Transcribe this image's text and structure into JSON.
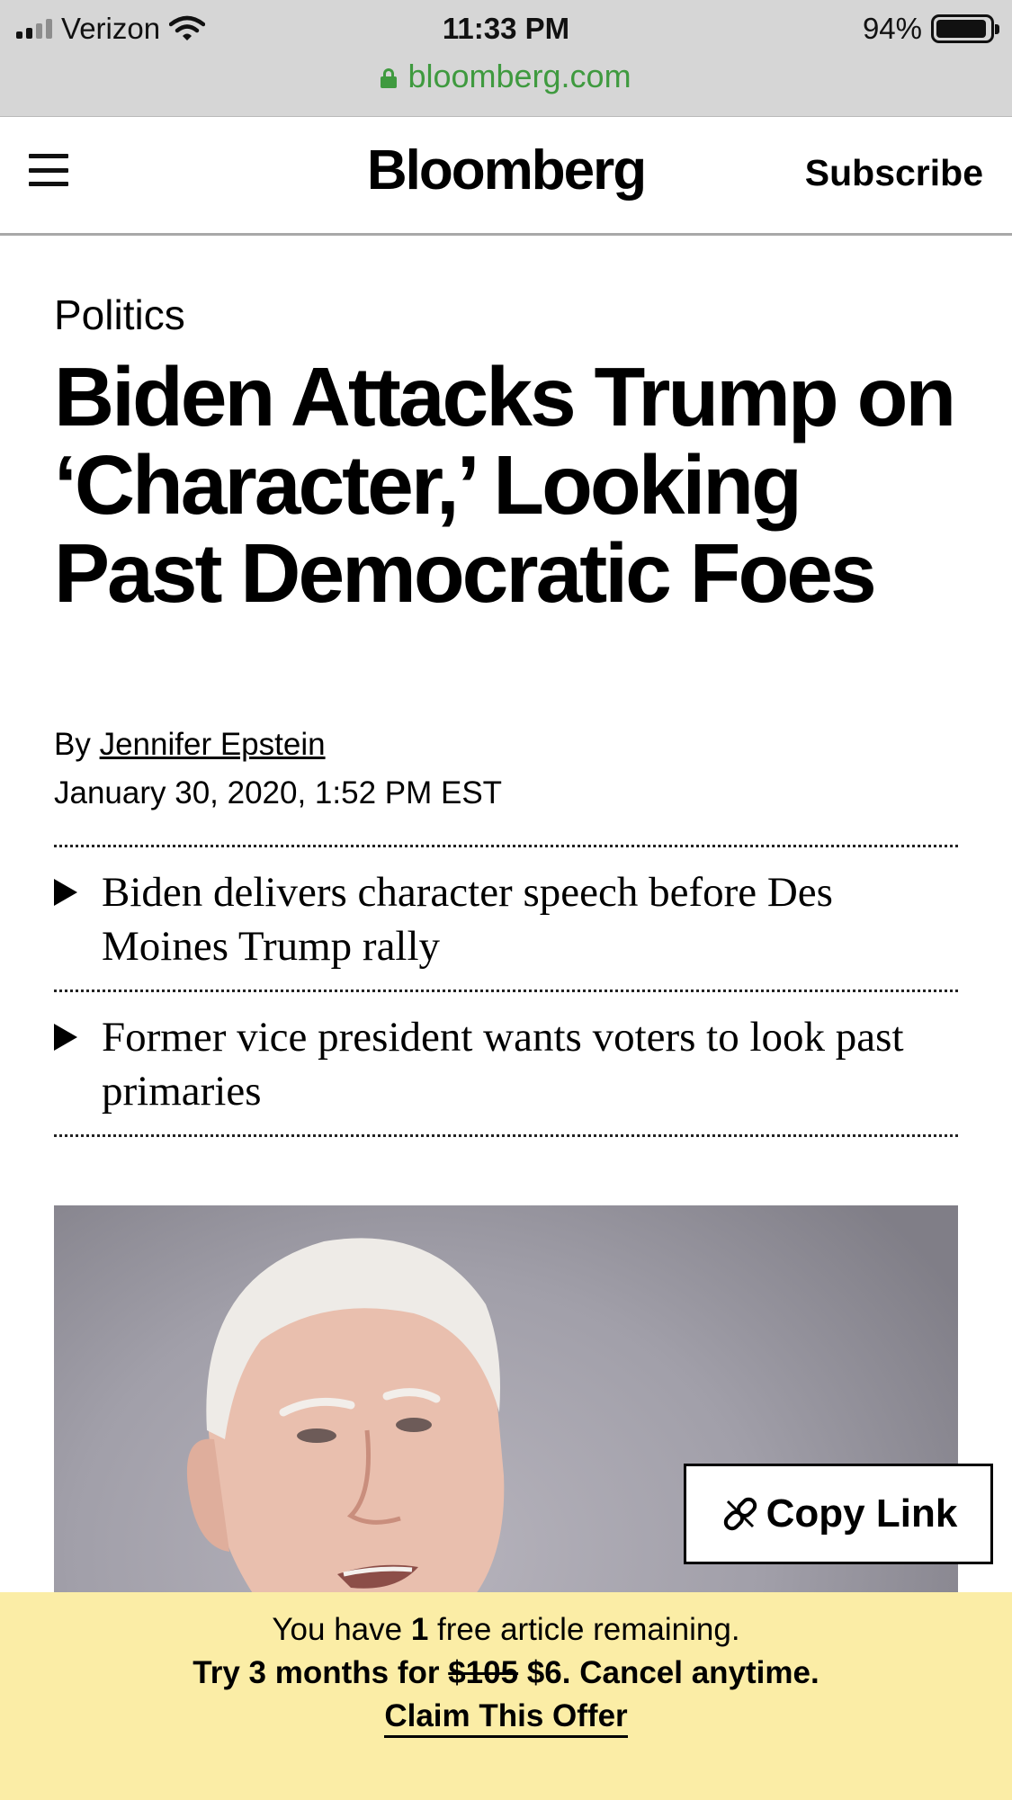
{
  "status_bar": {
    "carrier": "Verizon",
    "time": "11:33 PM",
    "battery": "94%",
    "battery_level": 0.94
  },
  "address_bar": {
    "url": "bloomberg.com"
  },
  "header": {
    "logo": "Bloomberg",
    "subscribe": "Subscribe"
  },
  "article": {
    "category": "Politics",
    "headline": "Biden Attacks Trump on ‘Character,’ Looking Past Democratic Foes",
    "byline_prefix": "By",
    "author": "Jennifer Epstein",
    "date": "January 30, 2020, 1:52 PM EST",
    "bullets": [
      "Biden delivers character speech before Des Moines Trump rally",
      "Former vice president wants voters to look past primaries"
    ]
  },
  "copy_link": {
    "label": "Copy Link"
  },
  "paywall": {
    "line1_prefix": "You have",
    "line1_count": "1",
    "line1_suffix": "free article remaining.",
    "line2_prefix": "Try 3 months for",
    "old_price": "$105",
    "new_price": "$6.",
    "line2_suffix": "Cancel anytime.",
    "cta": "Claim This Offer"
  },
  "colors": {
    "url_green": "#3f9a3f",
    "paywall_background": "#fbeda6"
  }
}
